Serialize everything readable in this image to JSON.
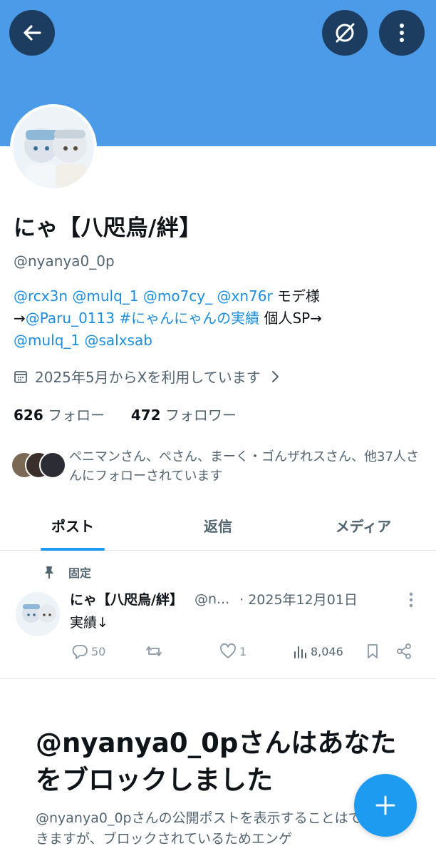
{
  "header": {
    "back_icon": "arrow-left-icon",
    "grok_icon": "grok-slash-circle-icon",
    "more_icon": "more-vertical-icon",
    "banner_color": "#4c9be8"
  },
  "profile": {
    "display_name": "にゃ【八咫烏/絆】",
    "handle": "@nyanya0_0p",
    "bio": {
      "line1_links": "@rcx3n @mulq_1 @mo7cy_ @xn76r",
      "line1_text": " モデ様",
      "line2_prefix": "→",
      "line2_links": "@Paru_0113 #にゃんにゃんの実績",
      "line2_text": " 個人SP→",
      "line3_links": "@mulq_1 @salxsab"
    },
    "joined": "2025年5月からXを利用しています",
    "following_count": "626",
    "following_label": "フォロー",
    "followers_count": "472",
    "followers_label": "フォロワー",
    "followed_by": "ペニマンさん、ぺさん、まーく・ゴんザれスさん、他37人さんにフォローされています"
  },
  "tabs": [
    {
      "label": "ポスト",
      "active": true
    },
    {
      "label": "返信",
      "active": false
    },
    {
      "label": "メディア",
      "active": false
    }
  ],
  "pinned_post": {
    "pinned_label": "固定",
    "author_name": "にゃ【八咫烏/絆】",
    "author_handle": "@n...",
    "date": "· 2025年12月01日",
    "text": "実績↓",
    "replies": "50",
    "likes": "1",
    "views": "8,046"
  },
  "blocked": {
    "title": "@nyanya0_0pさんはあなたをブロックしました",
    "description": "@nyanya0_0pさんの公開ポストを表示することはできますが、ブロックされているためエンゲ"
  },
  "colors": {
    "accent": "#1d9bf0",
    "link": "#1d8de0",
    "secondary_text": "#536471"
  }
}
